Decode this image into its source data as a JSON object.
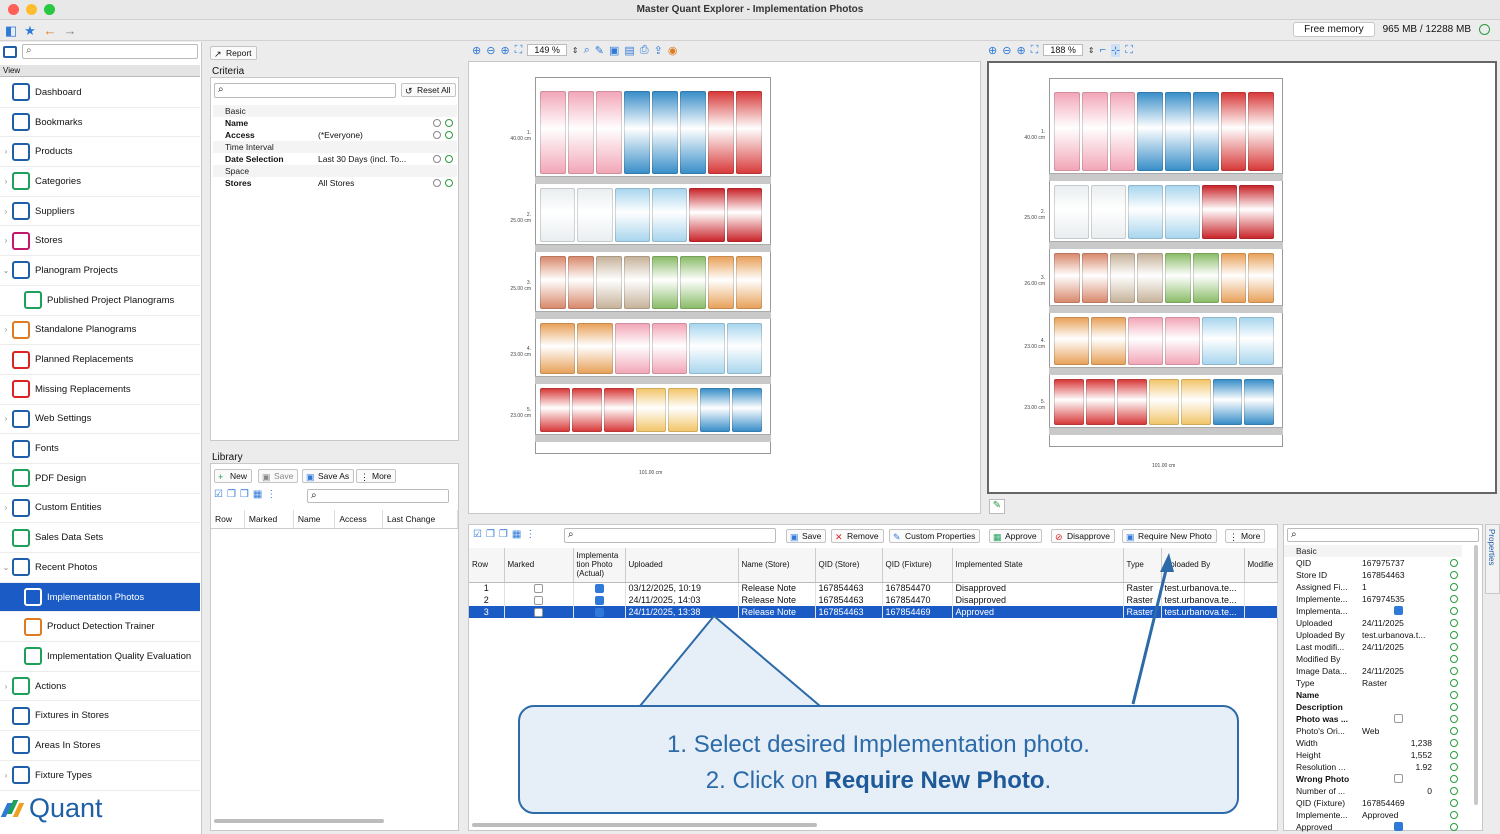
{
  "window": {
    "title": "Master Quant Explorer - Implementation Photos"
  },
  "memory": {
    "button": "Free memory",
    "value": "965 MB / 12288 MB"
  },
  "sidebar": {
    "view_label": "View",
    "items": [
      {
        "label": "Dashboard",
        "chev": "",
        "sub": false
      },
      {
        "label": "Bookmarks",
        "chev": "",
        "sub": false
      },
      {
        "label": "Products",
        "chev": "›",
        "sub": false
      },
      {
        "label": "Categories",
        "chev": "›",
        "sub": false
      },
      {
        "label": "Suppliers",
        "chev": "›",
        "sub": false
      },
      {
        "label": "Stores",
        "chev": "›",
        "sub": false
      },
      {
        "label": "Planogram Projects",
        "chev": "⌄",
        "sub": false
      },
      {
        "label": "Published Project Planograms",
        "chev": "",
        "sub": true
      },
      {
        "label": "Standalone Planograms",
        "chev": "›",
        "sub": false
      },
      {
        "label": "Planned Replacements",
        "chev": "",
        "sub": false
      },
      {
        "label": "Missing Replacements",
        "chev": "",
        "sub": false
      },
      {
        "label": "Web Settings",
        "chev": "›",
        "sub": false
      },
      {
        "label": "Fonts",
        "chev": "",
        "sub": false
      },
      {
        "label": "PDF Design",
        "chev": "",
        "sub": false
      },
      {
        "label": "Custom Entities",
        "chev": "›",
        "sub": false
      },
      {
        "label": "Sales Data Sets",
        "chev": "",
        "sub": false
      },
      {
        "label": "Recent Photos",
        "chev": "⌄",
        "sub": false
      },
      {
        "label": "Implementation Photos",
        "chev": "",
        "sub": true,
        "selected": true
      },
      {
        "label": "Product Detection Trainer",
        "chev": "",
        "sub": true
      },
      {
        "label": "Implementation Quality Evaluation",
        "chev": "",
        "sub": true
      },
      {
        "label": "Actions",
        "chev": "›",
        "sub": false
      },
      {
        "label": "Fixtures in Stores",
        "chev": "",
        "sub": false
      },
      {
        "label": "Areas In Stores",
        "chev": "",
        "sub": false
      },
      {
        "label": "Fixture Types",
        "chev": "›",
        "sub": false
      }
    ],
    "logo": "Quant"
  },
  "criteria": {
    "report_button": "Report",
    "title": "Criteria",
    "reset_button": "Reset All",
    "rows": [
      {
        "group": true,
        "key": "Basic",
        "value": ""
      },
      {
        "group": false,
        "key": "Name",
        "value": ""
      },
      {
        "group": false,
        "key": "Access",
        "value": "(*Everyone)"
      },
      {
        "group": true,
        "key": "Time Interval",
        "value": ""
      },
      {
        "group": false,
        "key": "Date Selection",
        "value": "Last 30 Days (incl. To..."
      },
      {
        "group": true,
        "key": "Space",
        "value": ""
      },
      {
        "group": false,
        "key": "Stores",
        "value": "All Stores"
      }
    ]
  },
  "library": {
    "title": "Library",
    "buttons": {
      "new": "New",
      "save": "Save",
      "save_as": "Save As",
      "more": "More"
    },
    "columns": [
      "Row",
      "Marked",
      "Name",
      "Access",
      "Last Change"
    ]
  },
  "viewer_left": {
    "zoom": "149 %"
  },
  "viewer_right": {
    "zoom": "188 %"
  },
  "planogram": {
    "width_label": "101.00 cm",
    "shelf_labels_left": [
      "1.\n40.00 cm",
      "2.\n25.00 cm",
      "3.\n25.00 cm",
      "4.\n23.00 cm",
      "5.\n23.00 cm"
    ],
    "shelf_labels_right": [
      "1.\n40.00 cm",
      "2.\n25.00 cm",
      "3.\n26.00 cm",
      "4.\n23.00 cm",
      "5.\n23.00 cm"
    ]
  },
  "grid_toolbar": {
    "save": "Save",
    "remove": "Remove",
    "custom_properties": "Custom Properties",
    "approve": "Approve",
    "disapprove": "Disapprove",
    "require_new_photo": "Require New Photo",
    "more": "More"
  },
  "grid": {
    "columns": [
      "Row",
      "Marked",
      "Implementa tion Photo (Actual)",
      "Uploaded",
      "Name (Store)",
      "QID (Store)",
      "QID (Fixture)",
      "Implemented State",
      "Type",
      "Uploaded By",
      "Modifie"
    ],
    "rows": [
      {
        "row": "1",
        "marked": false,
        "actual": true,
        "uploaded": "03/12/2025, 10:19",
        "name": "Release Note",
        "qid_store": "167854463",
        "qid_fixture": "167854470",
        "state": "Disapproved",
        "type": "Raster",
        "by": "test.urbanova.te...",
        "selected": false
      },
      {
        "row": "2",
        "marked": false,
        "actual": true,
        "uploaded": "24/11/2025, 14:03",
        "name": "Release Note",
        "qid_store": "167854463",
        "qid_fixture": "167854470",
        "state": "Disapproved",
        "type": "Raster",
        "by": "test.urbanova.te...",
        "selected": false
      },
      {
        "row": "3",
        "marked": false,
        "actual": true,
        "uploaded": "24/11/2025, 13:38",
        "name": "Release Note",
        "qid_store": "167854463",
        "qid_fixture": "167854469",
        "state": "Approved",
        "type": "Raster",
        "by": "test.urbanova.te...",
        "selected": true
      }
    ]
  },
  "properties": {
    "tab_label": "Properties",
    "rows": [
      {
        "group": true,
        "key": "Basic",
        "value": ""
      },
      {
        "key": "QID",
        "value": "167975737",
        "bold": false
      },
      {
        "key": "Store ID",
        "value": "167854463",
        "bold": false
      },
      {
        "key": "Assigned Fi...",
        "value": "1",
        "bold": false
      },
      {
        "key": "Implemente...",
        "value": "167974535",
        "bold": false
      },
      {
        "key": "Implementa...",
        "value": "",
        "check": true,
        "bold": false
      },
      {
        "key": "Uploaded",
        "value": "24/11/2025",
        "bold": false
      },
      {
        "key": "Uploaded By",
        "value": "test.urbanova.t...",
        "bold": false
      },
      {
        "key": "Last modifi...",
        "value": "24/11/2025",
        "bold": false
      },
      {
        "key": "Modified By",
        "value": "",
        "bold": false
      },
      {
        "key": "Image Data...",
        "value": "24/11/2025",
        "bold": false
      },
      {
        "key": "Type",
        "value": "Raster",
        "bold": false
      },
      {
        "key": "Name",
        "value": "",
        "bold": true
      },
      {
        "key": "Description",
        "value": "",
        "bold": true
      },
      {
        "key": "Photo was ...",
        "value": "",
        "check": false,
        "bold": true
      },
      {
        "key": "Photo's Ori...",
        "value": "Web",
        "bold": false
      },
      {
        "key": "Width",
        "value": "1,238",
        "bold": false,
        "num": true
      },
      {
        "key": "Height",
        "value": "1,552",
        "bold": false,
        "num": true
      },
      {
        "key": "Resolution ...",
        "value": "1.92",
        "bold": false,
        "num": true
      },
      {
        "key": "Wrong Photo",
        "value": "",
        "check": false,
        "bold": true
      },
      {
        "key": "Number of ...",
        "value": "0",
        "bold": false,
        "num": true
      },
      {
        "key": "QID (Fixture)",
        "value": "167854469",
        "bold": false
      },
      {
        "key": "Implemente...",
        "value": "Approved",
        "bold": false
      },
      {
        "key": "Approved",
        "value": "",
        "check": true,
        "bold": false
      }
    ]
  },
  "callout": {
    "line1": "1. Select desired Implementation photo.",
    "line2_prefix": "2. Click on ",
    "line2_bold": "Require New Photo",
    "line2_suffix": "."
  }
}
